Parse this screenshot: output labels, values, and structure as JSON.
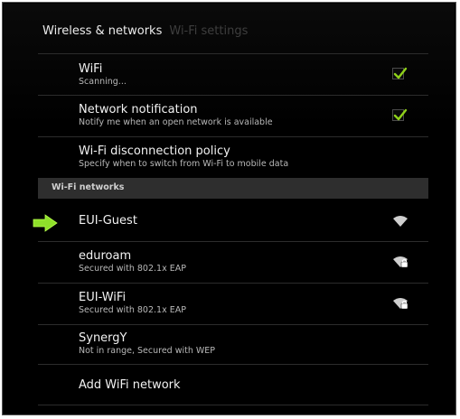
{
  "breadcrumb": {
    "active": "Wireless & networks",
    "inactive": "Wi-Fi settings"
  },
  "settings": [
    {
      "title": "WiFi",
      "summary": "Scanning...",
      "checked": true
    },
    {
      "title": "Network notification",
      "summary": "Notify me when an open network is available",
      "checked": true
    },
    {
      "title": "Wi-Fi disconnection policy",
      "summary": "Specify when to switch from Wi-Fi to mobile data"
    }
  ],
  "section_header": "Wi-Fi networks",
  "networks": [
    {
      "ssid": "EUI-Guest",
      "icon": "wifi-icon",
      "secured": false
    },
    {
      "ssid": "eduroam",
      "status": "Secured with 802.1x EAP",
      "icon": "wifi-lock-icon",
      "secured": true
    },
    {
      "ssid": "EUI-WiFi",
      "status": "Secured with 802.1x EAP",
      "icon": "wifi-lock-icon",
      "secured": true
    },
    {
      "ssid": "SynergY",
      "status": "Not in range, Secured with WEP"
    }
  ],
  "add_network": "Add WiFi network",
  "colors": {
    "background": "#000000",
    "check": "#8fd11a",
    "arrow": "#8fe02a",
    "section_header_bg": "#2e2e2e"
  }
}
